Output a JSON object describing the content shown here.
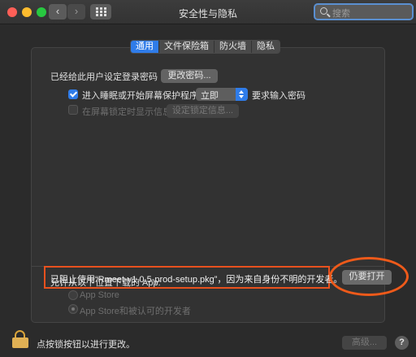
{
  "window": {
    "title": "安全性与隐私"
  },
  "search": {
    "placeholder": "搜索"
  },
  "tabs": [
    {
      "label": "通用",
      "active": true
    },
    {
      "label": "文件保险箱",
      "active": false
    },
    {
      "label": "防火墙",
      "active": false
    },
    {
      "label": "隐私",
      "active": false
    }
  ],
  "general": {
    "password_text": "已经给此用户设定登录密码",
    "change_password_button": "更改密码...",
    "sleep_checkbox_label": "进入睡眠或开始屏幕保护程序",
    "sleep_select_value": "立即",
    "require_password_label": "要求输入密码",
    "lock_message_checkbox_label": "在屏幕锁定时显示信息",
    "set_lock_message_button": "设定锁定信息..."
  },
  "downloads": {
    "heading": "允许从以下位置下载的 App:",
    "options": [
      {
        "label": "App Store",
        "selected": false
      },
      {
        "label": "App Store和被认可的开发者",
        "selected": true
      }
    ],
    "blocked_message": "已阻止使用“Rmeet-v1.0.5-prod-setup.pkg”，因为来自身份不明的开发者。",
    "open_anyway_button": "仍要打开"
  },
  "footer": {
    "lock_text": "点按锁按钮以进行更改。",
    "advanced_button": "高级...",
    "help_button": "?"
  },
  "colors": {
    "accent": "#2f7ce9",
    "highlight": "#e8511e"
  }
}
